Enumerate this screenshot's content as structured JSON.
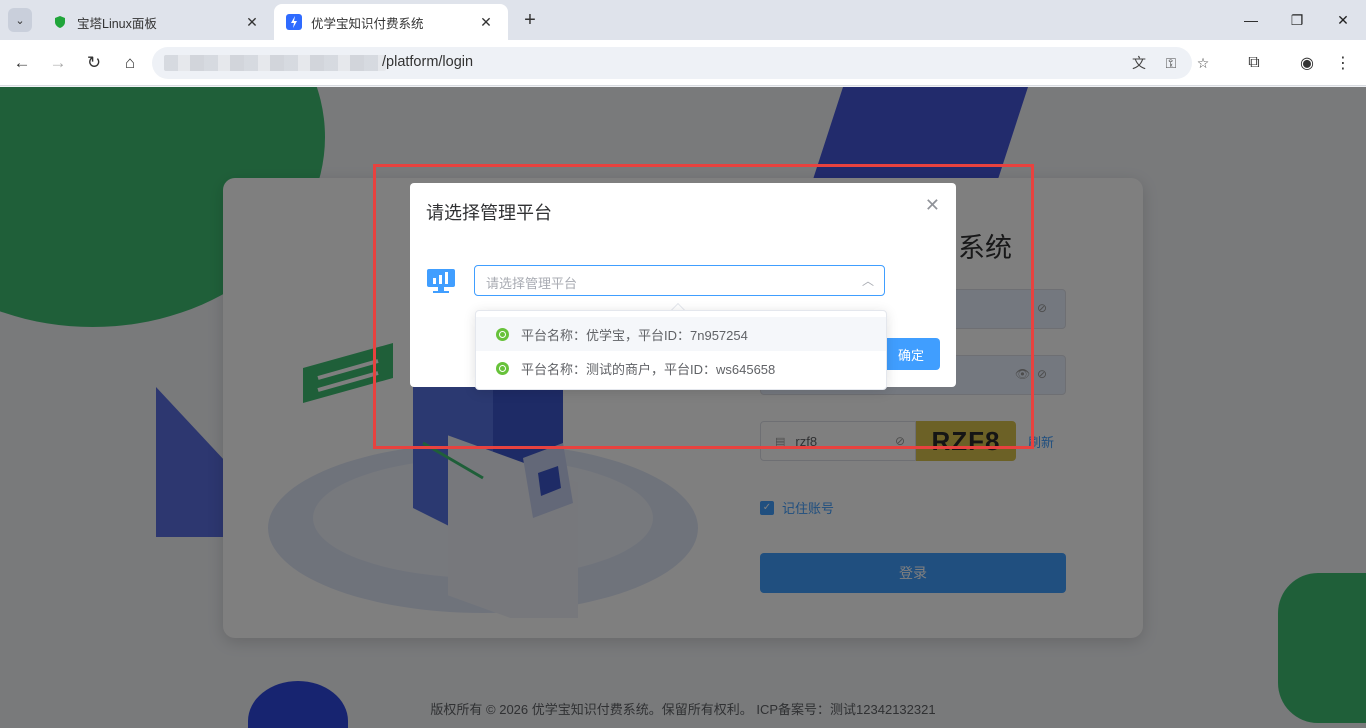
{
  "browser": {
    "tabs": [
      {
        "title": "宝塔Linux面板",
        "active": false
      },
      {
        "title": "优学宝知识付费系统",
        "active": true
      }
    ],
    "url": "/platform/login"
  },
  "login": {
    "title": "系统",
    "captcha_value": "rzf8",
    "captcha_text": "RZF8",
    "refresh_label": "刷新",
    "remember_label": "记住账号",
    "login_button": "登录"
  },
  "footer": {
    "text": "版权所有 © 2026 优学宝知识付费系统。保留所有权利。 ICP备案号：测试12342132321"
  },
  "dialog": {
    "title": "请选择管理平台",
    "select_placeholder": "请选择管理平台",
    "confirm_label": "确定",
    "options": [
      {
        "label": "平台名称：优学宝，平台ID：7n957254"
      },
      {
        "label": "平台名称：测试的商户，平台ID：ws645658"
      }
    ]
  },
  "colors": {
    "accent": "#409eff",
    "option_dot": "#67c23a",
    "highlight_box": "#e8423f"
  }
}
